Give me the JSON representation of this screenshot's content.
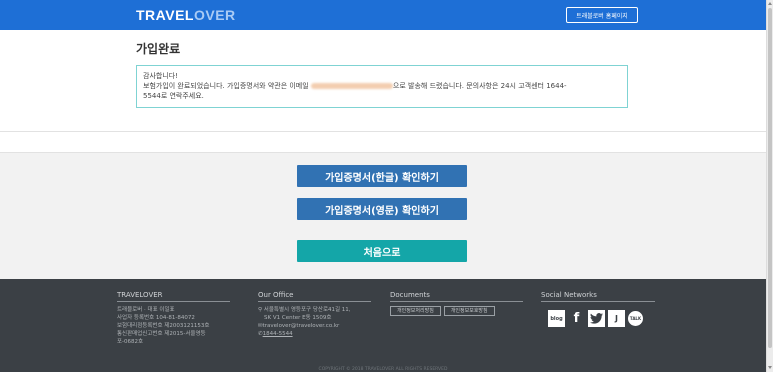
{
  "header": {
    "logo_travel": "TRAVEL",
    "logo_over": "OVER",
    "home_button": "트래블로버 홈페이지"
  },
  "main": {
    "title": "가입완료",
    "message": {
      "line1": "감사합니다!",
      "line2_pre": "보험가입이 완료되었습니다. 가입증명서와 약관은 이메일",
      "line2_post": "으로 발송해 드렸습니다. 문의사항은 24시 고객센터 1644-",
      "line3": "5544로 연락주세요."
    },
    "buttons": {
      "cert_korean": "가입증명서(한글) 확인하기",
      "cert_english": "가입증명서(영문) 확인하기",
      "home": "처음으로"
    }
  },
  "footer": {
    "company": {
      "heading": "TRAVELOVER",
      "lines": [
        "트래블로버 · 대표 이일표",
        "사업자 등록번호 104-81-84072",
        "보험대리점등록번호 제2003121153호",
        "통신판매업신고번호 제2015-서울영등",
        "포-0682호"
      ]
    },
    "office": {
      "heading": "Our Office",
      "address1": "서울특별시 영등포구 당산로41길 11,",
      "address2": "SK V1 Center E동 1509호",
      "email": "travelover@travelover.co.kr",
      "phone": "1844-5544"
    },
    "documents": {
      "heading": "Documents",
      "privacy": "개인정보처리방침",
      "protection": "개인정보보호방침"
    },
    "social": {
      "heading": "Social Networks",
      "icons": [
        "blog-icon",
        "facebook-icon",
        "twitter-icon",
        "post-icon",
        "talk-icon"
      ],
      "blog_text": "blog",
      "facebook_text": "f",
      "post_text": "J",
      "talk_text": "TALK"
    },
    "copyright": "COPYRIGHT © 2018 TRAVELOVER ALL RIGHTS RESERVED"
  },
  "colors": {
    "header": "#1e6fd6",
    "button_blue": "#3172b3",
    "button_teal": "#14a6a8",
    "footer": "#3b4045",
    "box_border": "#7fd3d3"
  }
}
